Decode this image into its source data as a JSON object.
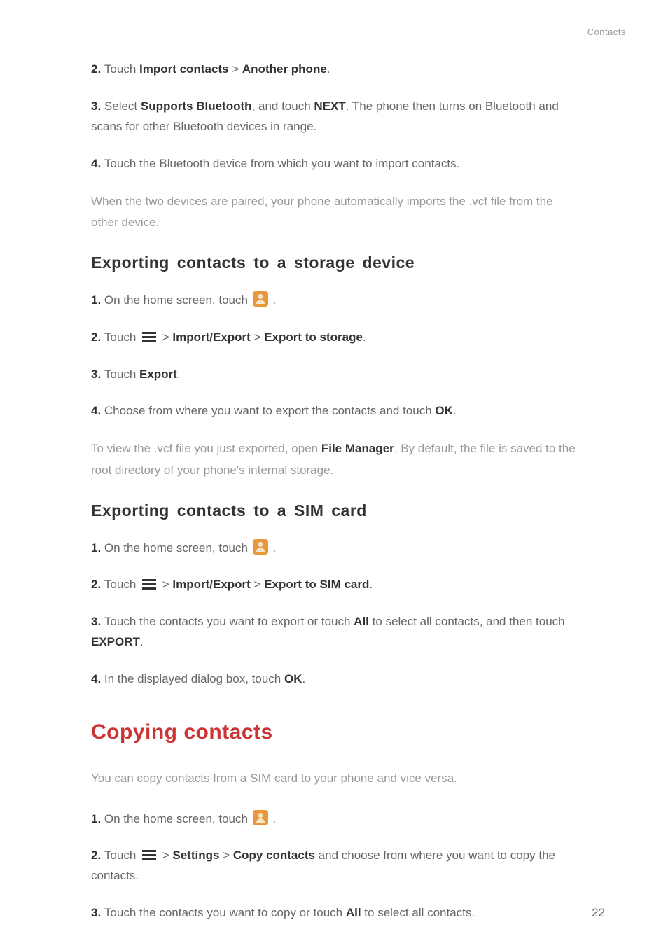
{
  "header": {
    "section_label": "Contacts"
  },
  "intro_steps": [
    {
      "num": "2.",
      "parts": [
        "Touch ",
        {
          "b": "Import contacts"
        },
        " > ",
        {
          "b": "Another phone"
        },
        "."
      ]
    },
    {
      "num": "3.",
      "parts": [
        "Select ",
        {
          "b": "Supports Bluetooth"
        },
        ", and touch ",
        {
          "b": "NEXT"
        },
        ". The phone then turns on Bluetooth and scans for other Bluetooth devices in range."
      ]
    },
    {
      "num": "4.",
      "parts": [
        "Touch the Bluetooth device from which you want to import contacts."
      ]
    }
  ],
  "intro_para": "When the two devices are paired, your phone automatically imports the .vcf file from the other device.",
  "section1": {
    "heading": "Exporting contacts to a storage device",
    "steps": [
      {
        "num": "1.",
        "parts": [
          "On the home screen, touch ",
          {
            "icon": "contacts"
          },
          " ."
        ]
      },
      {
        "num": "2.",
        "parts": [
          "Touch ",
          {
            "icon": "menu"
          },
          " > ",
          {
            "b": "Import/Export"
          },
          " > ",
          {
            "b": "Export to storage"
          },
          "."
        ]
      },
      {
        "num": "3.",
        "parts": [
          "Touch ",
          {
            "b": "Export"
          },
          "."
        ]
      },
      {
        "num": "4.",
        "parts": [
          "Choose from where you want to export the contacts and touch ",
          {
            "b": "OK"
          },
          "."
        ]
      }
    ],
    "para_parts": [
      "To view the .vcf file you just exported, open ",
      {
        "b": "File Manager"
      },
      ". By default, the file is saved to the root directory of your phone's internal storage."
    ]
  },
  "section2": {
    "heading": "Exporting contacts to a SIM card",
    "steps": [
      {
        "num": "1.",
        "parts": [
          "On the home screen, touch ",
          {
            "icon": "contacts"
          },
          " ."
        ]
      },
      {
        "num": "2.",
        "parts": [
          "Touch ",
          {
            "icon": "menu"
          },
          " > ",
          {
            "b": "Import/Export"
          },
          " > ",
          {
            "b": "Export to SIM card"
          },
          "."
        ]
      },
      {
        "num": "3.",
        "parts": [
          "Touch the contacts you want to export or touch ",
          {
            "b": "All"
          },
          " to select all contacts, and then touch ",
          {
            "b": "EXPORT"
          },
          "."
        ]
      },
      {
        "num": "4.",
        "parts": [
          "In the displayed dialog box, touch ",
          {
            "b": "OK"
          },
          "."
        ]
      }
    ]
  },
  "section3": {
    "heading": "Copying contacts",
    "intro": "You can copy contacts from a SIM card to your phone and vice versa.",
    "steps": [
      {
        "num": "1.",
        "parts": [
          "On the home screen, touch ",
          {
            "icon": "contacts"
          },
          " ."
        ]
      },
      {
        "num": "2.",
        "parts": [
          "Touch ",
          {
            "icon": "menu"
          },
          " > ",
          {
            "b": "Settings"
          },
          " > ",
          {
            "b": "Copy contacts"
          },
          " and choose from where you want to copy the contacts."
        ]
      },
      {
        "num": "3.",
        "parts": [
          "Touch the contacts you want to copy or touch ",
          {
            "b": "All"
          },
          " to select all contacts."
        ]
      }
    ]
  },
  "page_number": "22"
}
